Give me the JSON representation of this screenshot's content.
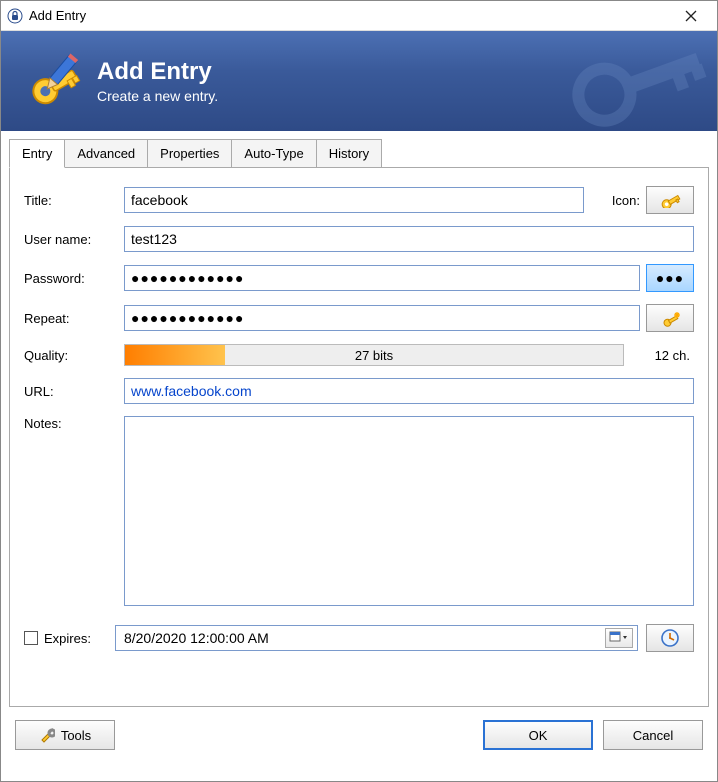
{
  "window": {
    "title": "Add Entry"
  },
  "banner": {
    "heading": "Add Entry",
    "subheading": "Create a new entry."
  },
  "tabs": [
    "Entry",
    "Advanced",
    "Properties",
    "Auto-Type",
    "History"
  ],
  "form": {
    "title_label": "Title:",
    "title_value": "facebook",
    "icon_label": "Icon:",
    "username_label": "User name:",
    "username_value": "test123",
    "password_label": "Password:",
    "password_mask": "●●●●●●●●●●●●",
    "repeat_label": "Repeat:",
    "repeat_mask": "●●●●●●●●●●●●",
    "quality_label": "Quality:",
    "quality_bits": "27 bits",
    "quality_chars": "12 ch.",
    "url_label": "URL:",
    "url_value": "www.facebook.com",
    "notes_label": "Notes:",
    "notes_value": "",
    "expires_label": "Expires:",
    "expires_value": "8/20/2020 12:00:00 AM"
  },
  "footer": {
    "tools": "Tools",
    "ok": "OK",
    "cancel": "Cancel"
  }
}
